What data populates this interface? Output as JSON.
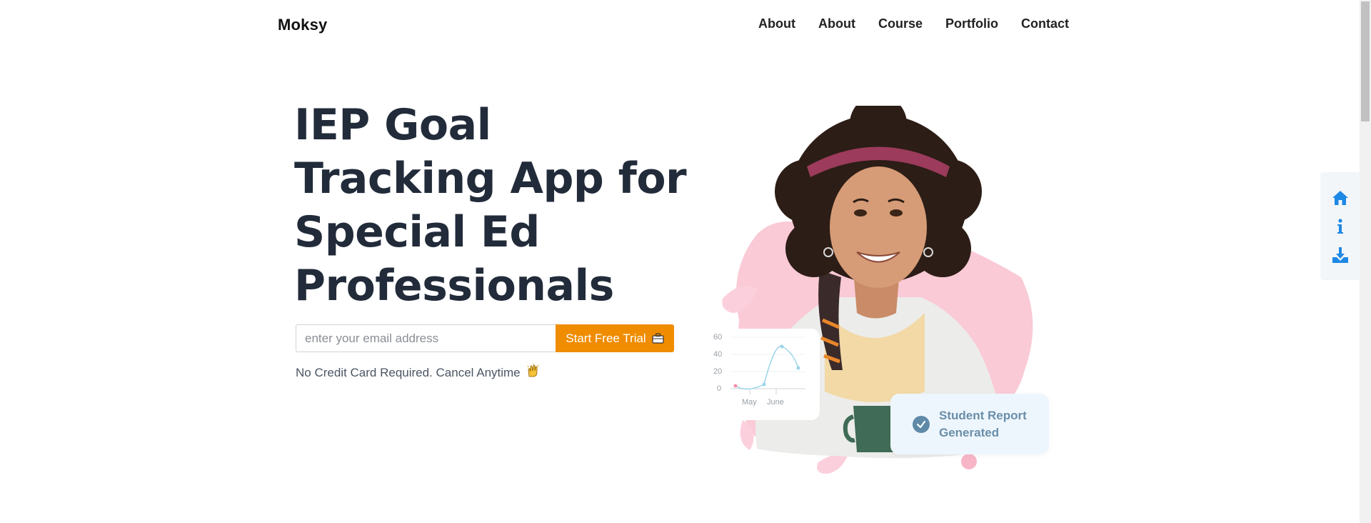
{
  "header": {
    "logo": "Moksy",
    "nav": [
      "About",
      "About",
      "Course",
      "Portfolio",
      "Contact"
    ]
  },
  "hero": {
    "title": "IEP Goal Tracking App for Special Ed Professionals",
    "email_placeholder": "enter your email address",
    "cta_label": "Start Free Trial",
    "note": "No Credit Card Required. Cancel Anytime"
  },
  "mini_chart": {
    "y_ticks": [
      "60",
      "40",
      "20",
      "0"
    ],
    "x_labels": [
      "May",
      "June"
    ]
  },
  "report_card": {
    "label": "Student Report Generated"
  },
  "side_toolbar": {
    "icons": [
      "home-icon",
      "info-icon",
      "download-icon"
    ]
  },
  "colors": {
    "accent": "#f08c00",
    "heading": "#222b3a",
    "toolbar_icon": "#1e88e5",
    "blob_pink": "#f9c4d2",
    "report_text": "#6a8ea8"
  }
}
